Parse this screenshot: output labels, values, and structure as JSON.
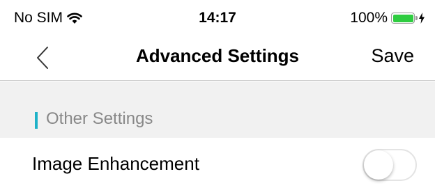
{
  "status_bar": {
    "carrier": "No SIM",
    "time": "14:17",
    "battery_percent": "100%",
    "battery_level": 1.0,
    "icons": [
      "wifi-icon",
      "battery-icon",
      "charging-icon"
    ]
  },
  "nav": {
    "back_icon": "chevron-left-icon",
    "title": "Advanced Settings",
    "save_label": "Save"
  },
  "section": {
    "title": "Other Settings",
    "accent_color": "#1eb2c8"
  },
  "settings": [
    {
      "label": "Image Enhancement",
      "enabled": false
    }
  ]
}
